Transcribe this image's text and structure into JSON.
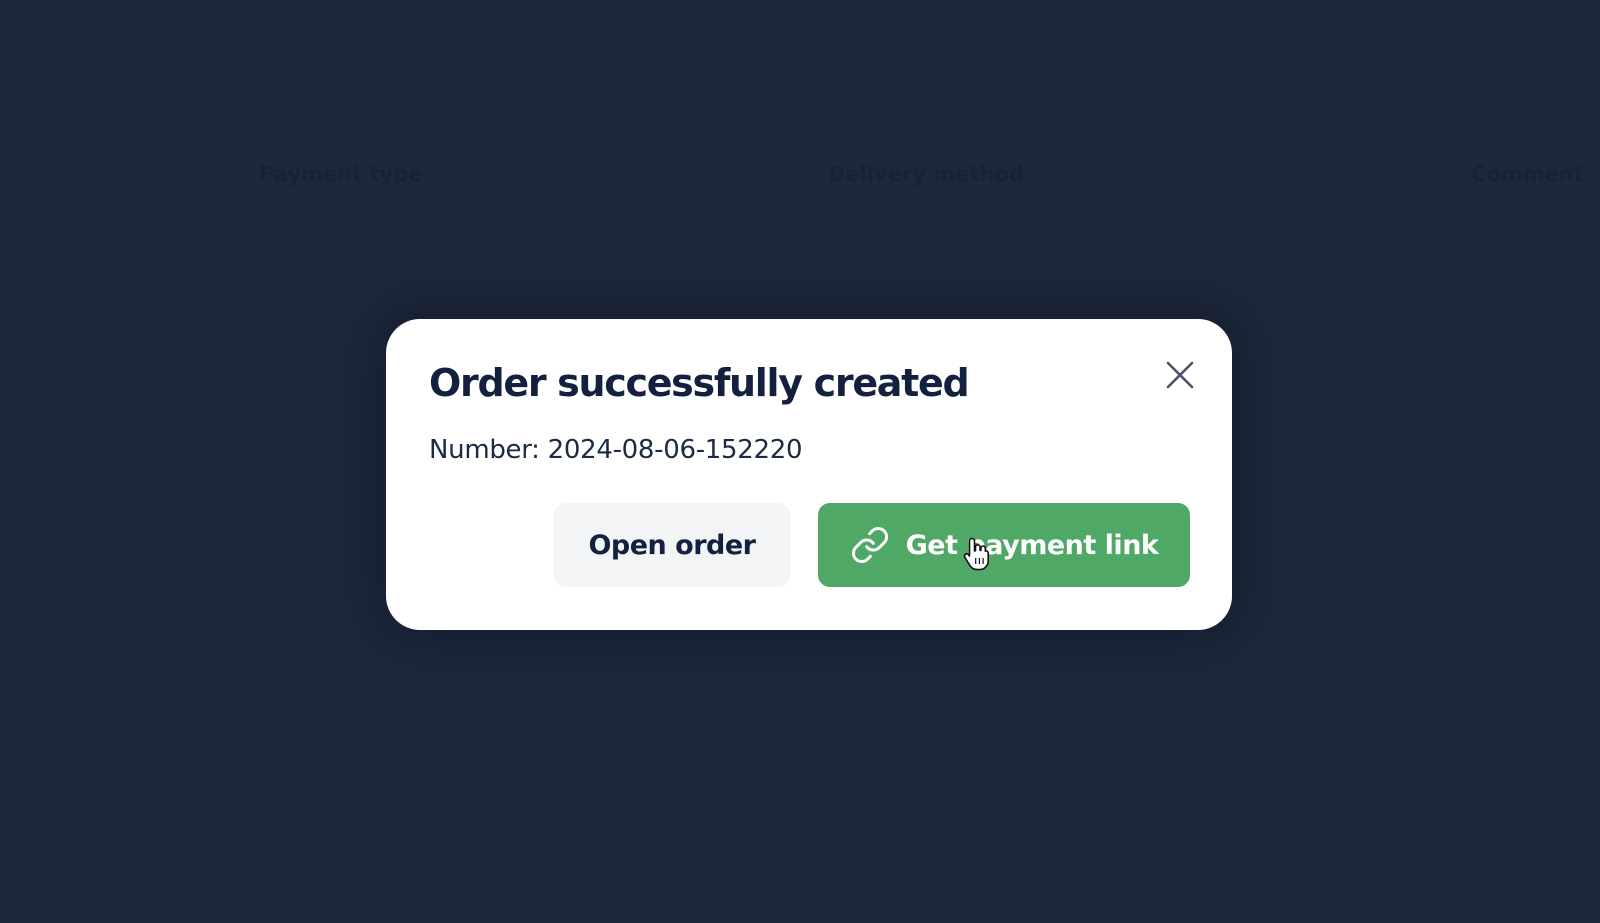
{
  "background": {
    "columns": {
      "payment_type": "Payment type",
      "delivery_method": "Delivery method",
      "comment": "Comment"
    }
  },
  "modal": {
    "title": "Order successfully created",
    "number_text": "Number: 2024-08-06-152220",
    "open_order_label": "Open order",
    "payment_link_label": "Get payment link",
    "close_icon": "close-icon",
    "link_icon": "link-icon"
  },
  "colors": {
    "page_bg": "#1e283b",
    "modal_bg": "#ffffff",
    "title_text": "#13213f",
    "primary_button": "#4fa866",
    "secondary_button": "#f3f4f6"
  }
}
